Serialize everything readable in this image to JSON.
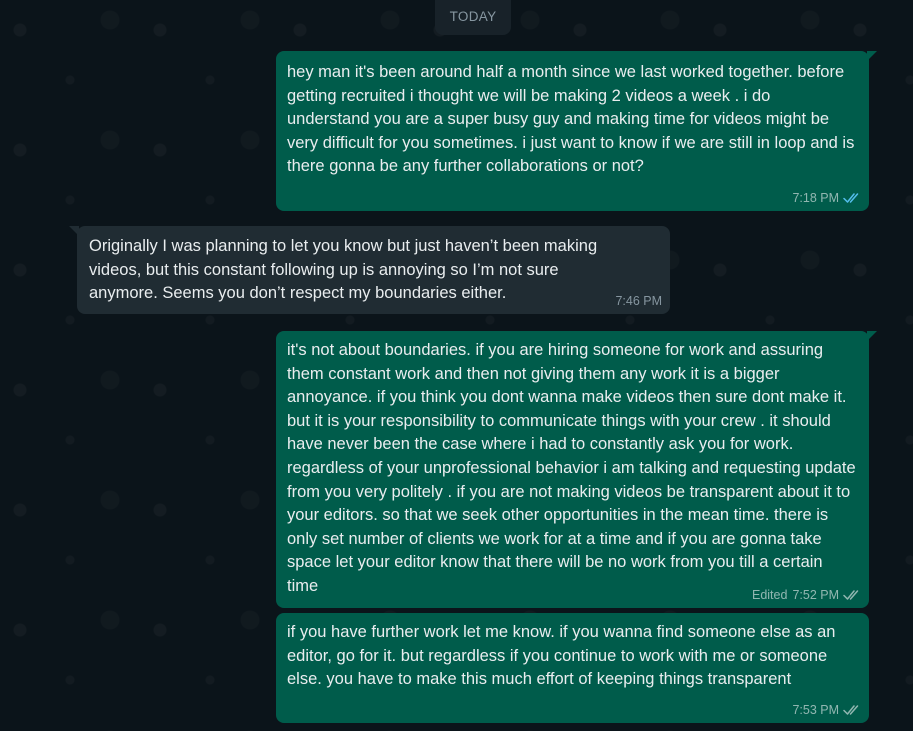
{
  "date_divider": "TODAY",
  "colors": {
    "background": "#0b141a",
    "outgoing_bubble": "#005c4b",
    "incoming_bubble": "#202c33",
    "read_tick": "#53bdeb"
  },
  "messages": [
    {
      "direction": "outgoing",
      "text": "hey man it's been around half a month since we last worked together. before getting recruited i thought we will be making 2 videos a week . i do understand you are a super busy guy and making time for videos might be very difficult for you sometimes. i just want to know if we are still in loop and is there gonna be any further collaborations or not?",
      "time": "7:18 PM",
      "status_icon": "double-check-read-icon"
    },
    {
      "direction": "incoming",
      "text": "Originally I was planning to let you know but just haven’t been making videos, but this constant following up is annoying so I’m not sure anymore. Seems you don’t respect my boundaries either.",
      "time": "7:46 PM"
    },
    {
      "direction": "outgoing",
      "text": "it's not about boundaries. if you are hiring someone for work and assuring them constant work and then not giving them any work it is a bigger annoyance. if you think you dont wanna make videos then sure dont make it. but it is your responsibility to communicate things with your crew . it should have never been the case where i had to constantly ask you for work. regardless of your unprofessional behavior i am talking and requesting update from you very politely . if you are not making videos be transparent about it to your editors. so that we seek other opportunities in the mean time. there is only set number of clients we work for at a time and if you are gonna take space let your editor know that there will be no work from you till a certain time",
      "edited_label": "Edited",
      "time": "7:52 PM",
      "status_icon": "double-check-delivered-icon"
    },
    {
      "direction": "outgoing",
      "text": "if you have further work let me know. if you wanna find someone else as an editor, go for it. but regardless if you continue to work with me or someone else. you have to make this much effort of keeping things transparent",
      "time": "7:53 PM",
      "status_icon": "double-check-delivered-icon"
    }
  ]
}
